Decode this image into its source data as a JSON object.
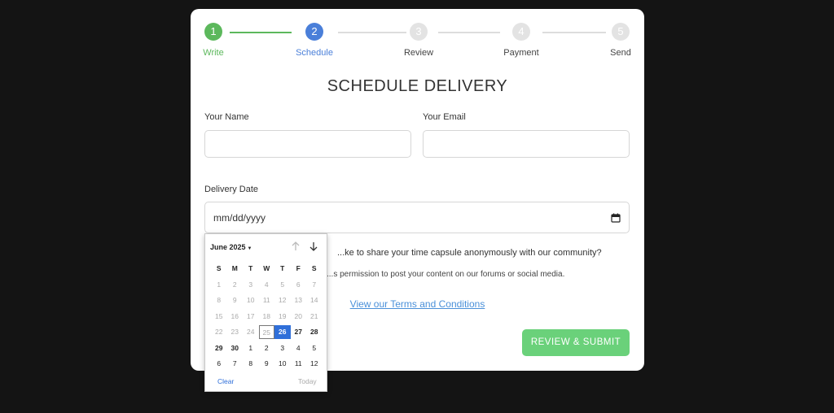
{
  "stepper": {
    "steps": [
      {
        "number": "1",
        "label": "Write",
        "state": "done"
      },
      {
        "number": "2",
        "label": "Schedule",
        "state": "active"
      },
      {
        "number": "3",
        "label": "Review",
        "state": "pending"
      },
      {
        "number": "4",
        "label": "Payment",
        "state": "pending"
      },
      {
        "number": "5",
        "label": "Send",
        "state": "pending"
      }
    ]
  },
  "form": {
    "title": "SCHEDULE DELIVERY",
    "name_label": "Your Name",
    "name_value": "",
    "email_label": "Your Email",
    "email_value": "",
    "date_label": "Delivery Date",
    "date_placeholder": "mm/dd/yyyy",
    "share_question": "...ke to share your time capsule anonymously with our community?",
    "permission_text": "...s permission to post your content on our forums or social media.",
    "terms_link": "View our Terms and Conditions",
    "submit_label": "REVIEW & SUBMIT"
  },
  "calendar": {
    "month_label": "June 2025",
    "weekdays": [
      "S",
      "M",
      "T",
      "W",
      "T",
      "F",
      "S"
    ],
    "weeks": [
      [
        "1",
        "2",
        "3",
        "4",
        "5",
        "6",
        "7"
      ],
      [
        "8",
        "9",
        "10",
        "11",
        "12",
        "13",
        "14"
      ],
      [
        "15",
        "16",
        "17",
        "18",
        "19",
        "20",
        "21"
      ],
      [
        "22",
        "23",
        "24",
        "25",
        "26",
        "27",
        "28"
      ],
      [
        "29",
        "30",
        "1",
        "2",
        "3",
        "4",
        "5"
      ],
      [
        "6",
        "7",
        "8",
        "9",
        "10",
        "11",
        "12"
      ]
    ],
    "selected_day": "26",
    "focused_day": "25",
    "clear_label": "Clear",
    "today_label": "Today"
  },
  "colors": {
    "done": "#5cb85c",
    "active": "#4a7fd9",
    "submit": "#6ad17a",
    "link": "#4a90d9",
    "selected": "#2f6fd9"
  }
}
